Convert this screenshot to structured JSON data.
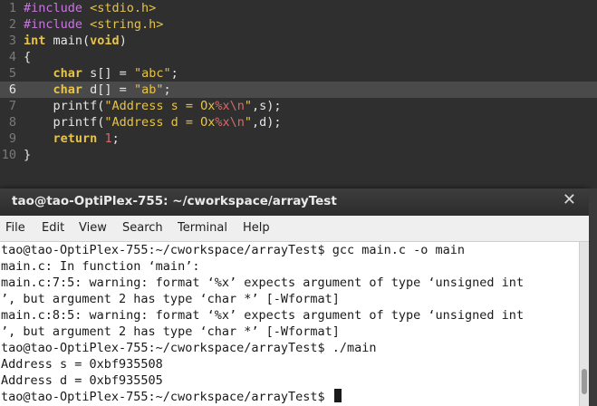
{
  "editor": {
    "line_numbers": [
      "1",
      "2",
      "3",
      "4",
      "5",
      "6",
      "7",
      "8",
      "9",
      "10"
    ],
    "lines": {
      "l1": {
        "pp": "#include ",
        "inc": "<stdio.h>"
      },
      "l2": {
        "pp": "#include ",
        "inc": "<string.h>"
      },
      "l3": {
        "kw": "int",
        "rest1": " main(",
        "kw2": "void",
        "rest2": ")"
      },
      "l4": {
        "text": "{"
      },
      "l5": {
        "indent": "    ",
        "kw": "char",
        "rest": " s[] = ",
        "str": "\"abc\"",
        "end": ";"
      },
      "l6": {
        "indent": "    ",
        "kw": "char",
        "rest": " d[] = ",
        "str": "\"ab\"",
        "end": ";"
      },
      "l7": {
        "indent": "    ",
        "call": "printf(",
        "str1": "\"Address s = Ox",
        "fmt": "%x\\n",
        "str2": "\"",
        "end": ",s);"
      },
      "l8": {
        "indent": "    ",
        "call": "printf(",
        "str1": "\"Address d = Ox",
        "fmt": "%x\\n",
        "str2": "\"",
        "end": ",d);"
      },
      "l9": {
        "indent": "    ",
        "kw": "return",
        "sp": " ",
        "num": "1",
        "end": ";"
      },
      "l10": {
        "text": "}"
      }
    },
    "current_line": 6
  },
  "terminal": {
    "title": "tao@tao-OptiPlex-755: ~/cworkspace/arrayTest",
    "close_glyph": "✕",
    "menu": [
      "File",
      "Edit",
      "View",
      "Search",
      "Terminal",
      "Help"
    ],
    "lines": [
      "tao@tao-OptiPlex-755:~/cworkspace/arrayTest$ gcc main.c -o main",
      "main.c: In function ‘main’:",
      "main.c:7:5: warning: format ‘%x’ expects argument of type ‘unsigned int",
      "’, but argument 2 has type ‘char *’ [-Wformat]",
      "main.c:8:5: warning: format ‘%x’ expects argument of type ‘unsigned int",
      "’, but argument 2 has type ‘char *’ [-Wformat]",
      "tao@tao-OptiPlex-755:~/cworkspace/arrayTest$ ./main",
      "Address s = 0xbf935508",
      "Address d = 0xbf935505"
    ],
    "prompt": "tao@tao-OptiPlex-755:~/cworkspace/arrayTest$ "
  },
  "colors": {
    "editor_bg": "#2f2f2f",
    "keyword": "#e6c34a",
    "preprocessor": "#c678dd",
    "escape": "#d46b6b",
    "terminal_bg": "#ffffff"
  }
}
